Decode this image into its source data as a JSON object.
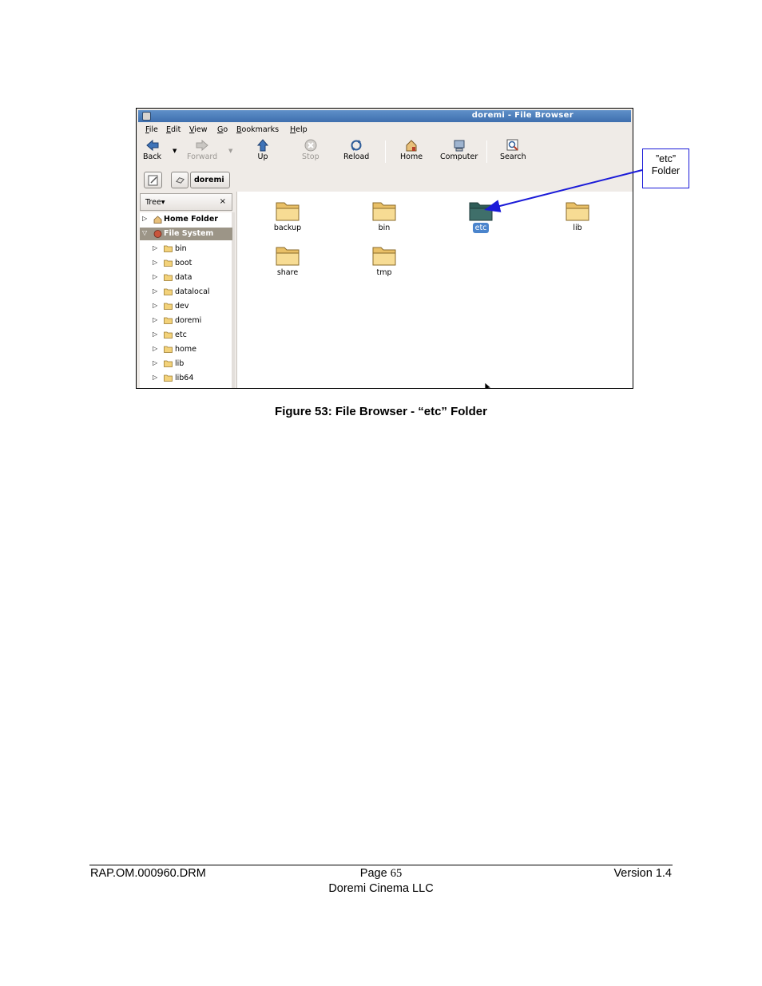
{
  "window": {
    "title": "doremi - File Browser",
    "menu": [
      "File",
      "Edit",
      "View",
      "Go",
      "Bookmarks",
      "Help"
    ],
    "toolbar": {
      "back": "Back",
      "forward": "Forward",
      "up": "Up",
      "stop": "Stop",
      "reload": "Reload",
      "home": "Home",
      "computer": "Computer",
      "search": "Search"
    },
    "location": {
      "path_button": "doremi"
    },
    "sidebar": {
      "header": "Tree",
      "close": "×",
      "home_folder": "Home Folder",
      "file_system": "File System",
      "folders": [
        "bin",
        "boot",
        "data",
        "datalocal",
        "dev",
        "doremi",
        "etc",
        "home",
        "lib",
        "lib64"
      ]
    },
    "icons": [
      "backup",
      "bin",
      "etc",
      "lib",
      "share",
      "tmp"
    ],
    "selected_icon": "etc"
  },
  "callout": {
    "line1": "”etc”",
    "line2": "Folder"
  },
  "caption": "Figure 53: File Browser - “etc” Folder",
  "footer": {
    "doc_id": "RAP.OM.000960.DRM",
    "page_label": "Page",
    "page_number": "65",
    "version": "Version 1.4",
    "company": "Doremi Cinema LLC"
  },
  "colors": {
    "titlebar": "#4a7bbb",
    "selection": "#4a84cc",
    "folder": "#f3d27a",
    "folder_open": "#3f6f6a",
    "callout_border": "#1a1ad8"
  }
}
